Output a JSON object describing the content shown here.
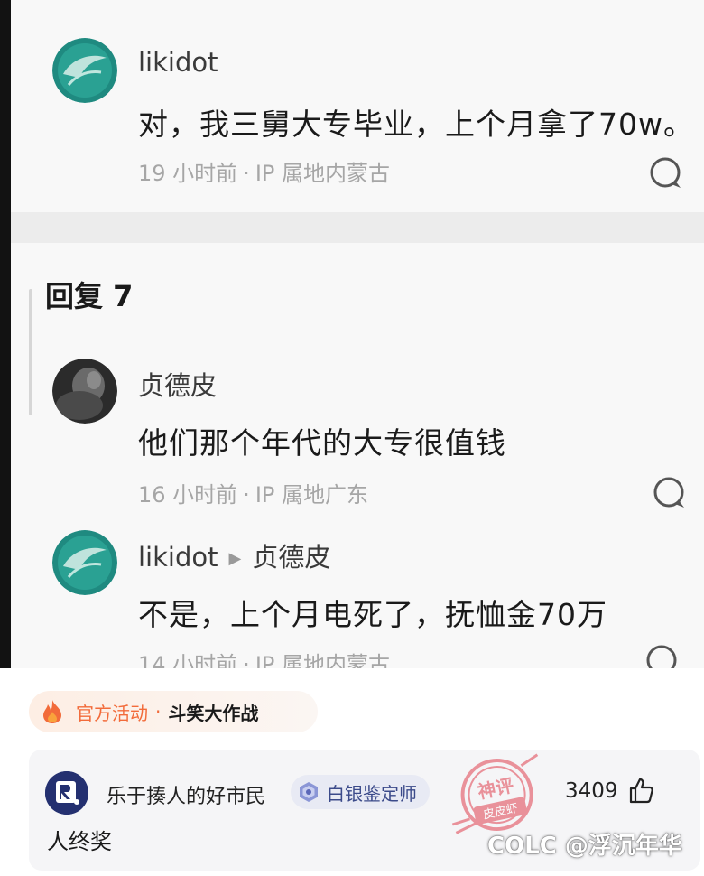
{
  "comments": {
    "top": {
      "username": "likidot",
      "text": "对，我三舅大专毕业，上个月拿了70w。",
      "time": "19 小时前",
      "location": "IP 属地内蒙古"
    },
    "reply_header": "回复 7",
    "replies": [
      {
        "username": "贞德皮",
        "text": "他们那个年代的大专很值钱",
        "time": "16 小时前",
        "location": "IP 属地广东"
      },
      {
        "username": "likidot",
        "reply_to": "贞德皮",
        "text": "不是，上个月电死了，抚恤金70万",
        "time": "14 小时前",
        "location": "IP 属地内蒙古"
      }
    ]
  },
  "activity": {
    "tag": "官方活动",
    "separator": "·",
    "name": "斗笑大作战"
  },
  "comment_card": {
    "username": "乐于揍人的好市民",
    "badge": "白银鉴定师",
    "likes": "3409",
    "text": "人终奖"
  },
  "stamp": {
    "line1": "神评",
    "line2": "皮皮虾"
  },
  "watermark": "COLC @浮沉年华",
  "icons": {
    "reply": "comment-bubble-icon",
    "fire": "fire-icon",
    "badge": "silver-badge-icon",
    "like": "thumbs-up-icon"
  },
  "colors": {
    "accent_orange": "#f26b3a",
    "badge_blue": "#3b4a8a",
    "stamp_red": "#e0414f"
  }
}
